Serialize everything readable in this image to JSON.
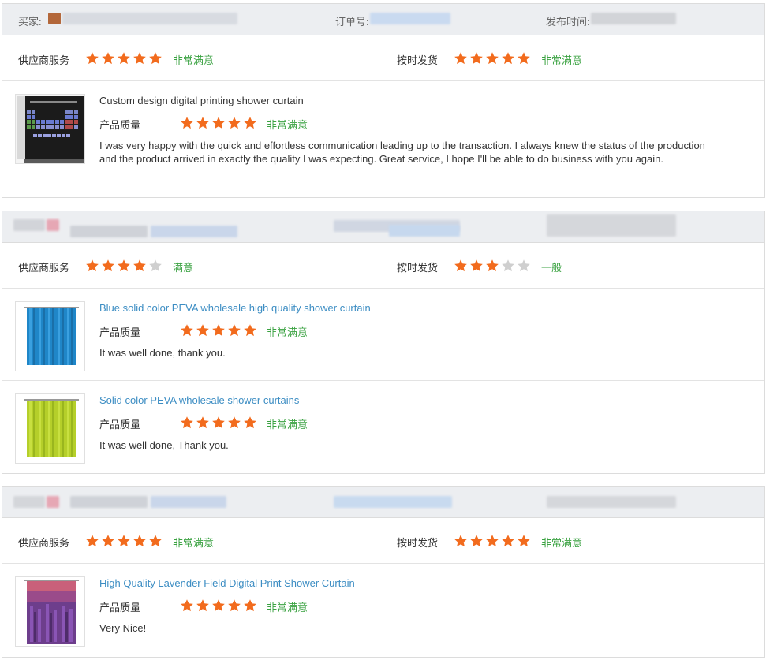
{
  "colors": {
    "star_on": "#f26b1d",
    "star_off": "#cfcfcf",
    "rating_text": "#3aa241",
    "link": "#3c8dc3",
    "header_bg": "#eceef1"
  },
  "header_labels": {
    "buyer": "买家:",
    "order_no": "订单号:",
    "publish_time": "发布时间:"
  },
  "labels": {
    "supplier_service": "供应商服务",
    "on_time_delivery": "按时发货",
    "product_quality": "产品质量"
  },
  "reviews": [
    {
      "supplier_service": {
        "stars": 5,
        "text": "非常满意"
      },
      "on_time_delivery": {
        "stars": 5,
        "text": "非常满意"
      },
      "items": [
        {
          "title": "Custom design digital printing shower curtain",
          "title_is_link": false,
          "thumb_icon": "periodic-table-curtain",
          "quality": {
            "stars": 5,
            "text": "非常满意"
          },
          "comment": "I was very happy with the quick and effortless communication leading up to the transaction. I always knew the status of the production and the product arrived in exactly the quality I was expecting. Great service, I hope I'll be able to do business with you again."
        }
      ]
    },
    {
      "supplier_service": {
        "stars": 4,
        "text": "满意"
      },
      "on_time_delivery": {
        "stars": 3,
        "text": "一般"
      },
      "items": [
        {
          "title": "Blue solid color PEVA wholesale high quality shower curtain",
          "title_is_link": true,
          "thumb_icon": "blue-curtain",
          "quality": {
            "stars": 5,
            "text": "非常满意"
          },
          "comment": "It was well done, thank you."
        },
        {
          "title": "Solid color PEVA wholesale shower curtains",
          "title_is_link": true,
          "thumb_icon": "green-curtain",
          "quality": {
            "stars": 5,
            "text": "非常满意"
          },
          "comment": "It was well done, Thank you."
        }
      ]
    },
    {
      "supplier_service": {
        "stars": 5,
        "text": "非常满意"
      },
      "on_time_delivery": {
        "stars": 5,
        "text": "非常满意"
      },
      "items": [
        {
          "title": "High Quality Lavender Field Digital Print Shower Curtain",
          "title_is_link": true,
          "thumb_icon": "lavender-curtain",
          "quality": {
            "stars": 5,
            "text": "非常满意"
          },
          "comment": "Very Nice!"
        }
      ]
    }
  ]
}
